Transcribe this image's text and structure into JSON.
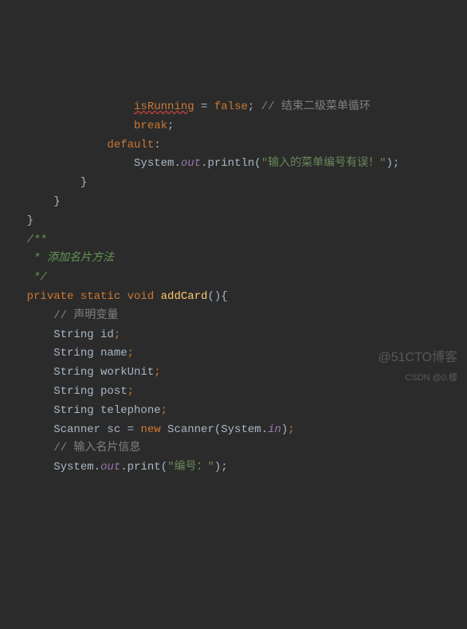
{
  "code": {
    "l1_a": "isRunning",
    "l1_b": " = ",
    "l1_c": "false",
    "l1_d": "; ",
    "l1_e": "// 结束二级菜单循环",
    "l2_a": "break",
    "l2_b": ";",
    "l3_a": "default",
    "l3_b": ":",
    "l4_a": "System.",
    "l4_b": "out",
    "l4_c": ".println(",
    "l4_d": "\"输入的菜单编号有误！\"",
    "l4_e": ");",
    "l5": "}",
    "l6": "}",
    "l7": "}",
    "l8": "/**",
    "l9": " * 添加名片方法",
    "l10": " */",
    "l11_a": "private static void ",
    "l11_b": "addCard",
    "l11_c": "(){",
    "l12": "// 声明变量",
    "l13_a": "String id",
    "l13_b": ";",
    "l14_a": "String name",
    "l14_b": ";",
    "l15_a": "String workUnit",
    "l15_b": ";",
    "l16_a": "String post",
    "l16_b": ";",
    "l17_a": "String telephone",
    "l17_b": ";",
    "l18_a": "Scanner sc = ",
    "l18_b": "new ",
    "l18_c": "Scanner(System.",
    "l18_d": "in",
    "l18_e": ")",
    "l18_f": ";",
    "l19": "// 输入名片信息",
    "l20_a": "System.",
    "l20_b": "out",
    "l20_c": ".print(",
    "l20_d": "\"编号：\"",
    "l20_e": ");"
  },
  "watermark": {
    "primary": "@51CTO博客",
    "secondary": "CSDN @0.樱"
  }
}
